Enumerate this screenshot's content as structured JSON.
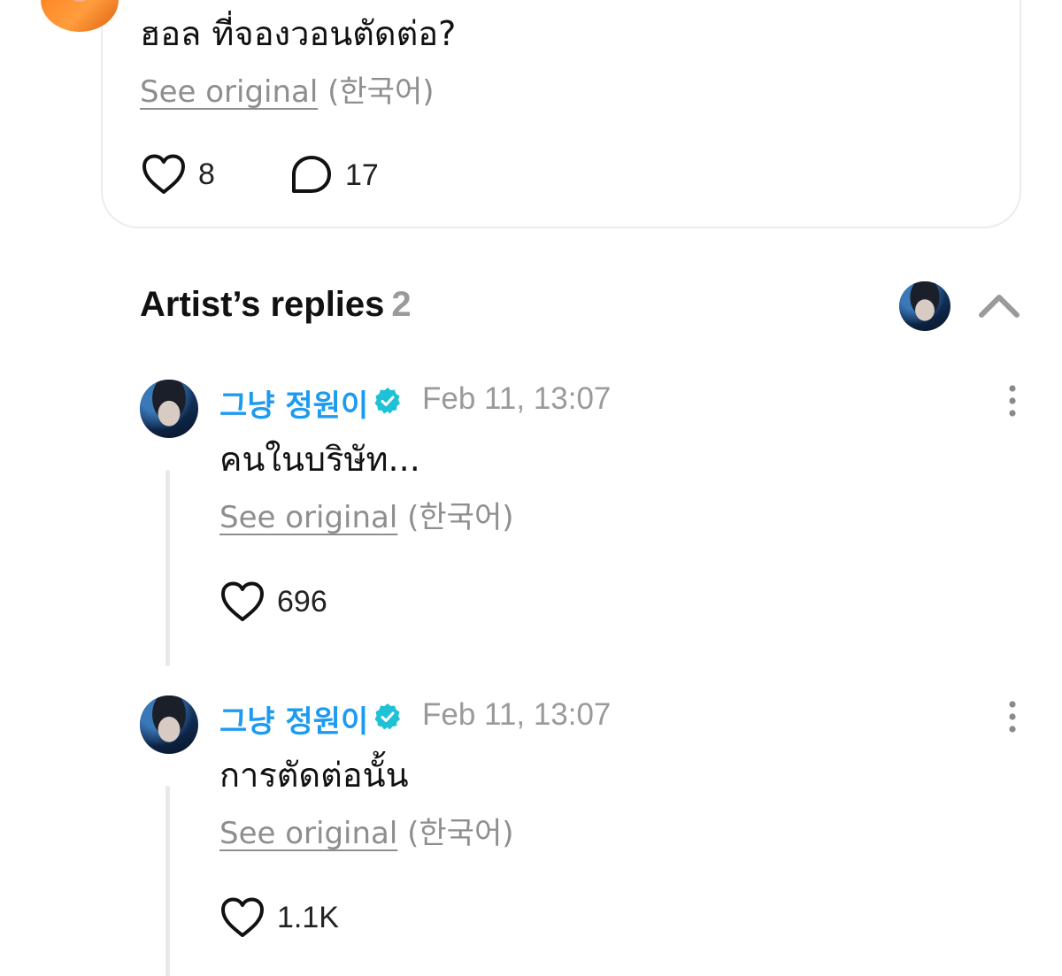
{
  "post": {
    "text": "ฮอล ที่จองวอนตัดต่อ?",
    "see_original": "See original",
    "language": "(한국어)",
    "likes": "8",
    "comments": "17"
  },
  "replies_section": {
    "title": "Artist’s replies",
    "count": "2"
  },
  "replies": [
    {
      "author": "그냥 정원이",
      "date": "Feb 11, 13:07",
      "text": "คนในบริษัท...",
      "see_original": "See original",
      "language": "(한국어)",
      "likes": "696"
    },
    {
      "author": "그냥 정원이",
      "date": "Feb 11, 13:07",
      "text": "การตัดต่อนั้น",
      "see_original": "See original",
      "language": "(한국어)",
      "likes": "1.1K"
    }
  ],
  "colors": {
    "author_name": "#1d9bf0",
    "verified_badge": "#1fc1d6",
    "muted_text": "#8e8e8e"
  },
  "icons": [
    "heart-icon",
    "comment-bubble-icon",
    "verified-badge-icon",
    "chevron-up-icon",
    "more-vertical-icon"
  ]
}
